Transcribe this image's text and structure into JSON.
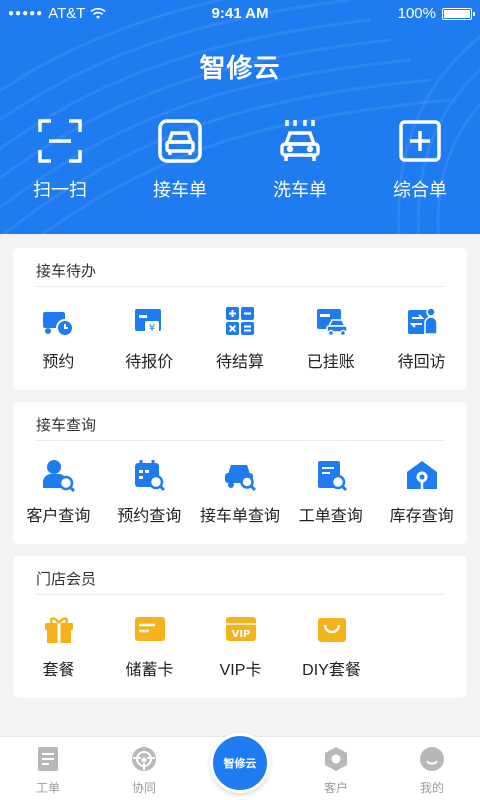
{
  "status_bar": {
    "carrier": "AT&T",
    "time": "9:41 AM",
    "battery": "100%"
  },
  "app_title": "智修云",
  "quick_actions": [
    {
      "label": "扫一扫",
      "icon": "scan-icon"
    },
    {
      "label": "接车单",
      "icon": "car-front-icon"
    },
    {
      "label": "洗车单",
      "icon": "car-wash-icon"
    },
    {
      "label": "综合单",
      "icon": "add-box-icon"
    }
  ],
  "sections": {
    "pending": {
      "title": "接车待办",
      "items": [
        {
          "label": "预约",
          "icon": "truck-clock-icon"
        },
        {
          "label": "待报价",
          "icon": "quote-card-icon"
        },
        {
          "label": "待结算",
          "icon": "calculator-icon"
        },
        {
          "label": "已挂账",
          "icon": "card-car-icon"
        },
        {
          "label": "待回访",
          "icon": "revisit-person-icon"
        }
      ]
    },
    "query": {
      "title": "接车查询",
      "items": [
        {
          "label": "客户查询",
          "icon": "customer-search-icon"
        },
        {
          "label": "预约查询",
          "icon": "calendar-search-icon"
        },
        {
          "label": "接车单查询",
          "icon": "car-search-icon"
        },
        {
          "label": "工单查询",
          "icon": "document-search-icon"
        },
        {
          "label": "库存查询",
          "icon": "warehouse-search-icon"
        }
      ]
    },
    "member": {
      "title": "门店会员",
      "items": [
        {
          "label": "套餐",
          "icon": "gift-icon"
        },
        {
          "label": "储蓄卡",
          "icon": "savings-card-icon"
        },
        {
          "label": "VIP卡",
          "icon": "vip-card-icon"
        },
        {
          "label": "DIY套餐",
          "icon": "diy-bag-icon"
        }
      ]
    }
  },
  "vip_badge": "VIP",
  "tabbar": {
    "items": [
      {
        "label": "工单",
        "icon": "document-icon"
      },
      {
        "label": "协同",
        "icon": "steering-wheel-icon"
      },
      {
        "label": "",
        "icon": "logo-icon"
      },
      {
        "label": "客户",
        "icon": "hexagon-nut-icon"
      },
      {
        "label": "我的",
        "icon": "smile-face-icon"
      }
    ],
    "center_logo_text": "智修云"
  },
  "colors": {
    "primary": "#1f7cf0",
    "accent_orange": "#f6b21b",
    "tab_inactive": "#9a9a9a"
  }
}
